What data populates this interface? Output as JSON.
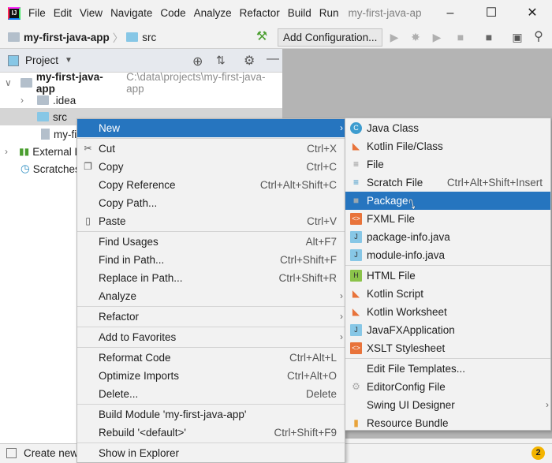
{
  "titlebar": {
    "menus": [
      "File",
      "Edit",
      "View",
      "Navigate",
      "Code",
      "Analyze",
      "Refactor",
      "Build",
      "Run"
    ],
    "title": "my-first-java-ap"
  },
  "toolbar": {
    "project": "my-first-java-app",
    "folder": "src",
    "add_config": "Add Configuration..."
  },
  "project_panel": {
    "title": "Project"
  },
  "tree": [
    {
      "label": "my-first-java-app",
      "path": "C:\\data\\projects\\my-first-java-app",
      "bold": true
    },
    {
      "label": ".idea"
    },
    {
      "label": "src"
    },
    {
      "label": "my-fi"
    },
    {
      "label": "External L"
    },
    {
      "label": "Scratches"
    }
  ],
  "status": {
    "text": "Create new",
    "badge": "2",
    "badge_color": "#f4b400"
  },
  "accent": "#2675bf",
  "context_menu": [
    {
      "label": "New",
      "submenu": true,
      "highlighted": true
    },
    {
      "sep": true
    },
    {
      "label": "Cut",
      "shortcut": "Ctrl+X",
      "icon": "scissors-icon"
    },
    {
      "label": "Copy",
      "shortcut": "Ctrl+C",
      "icon": "copy-icon"
    },
    {
      "label": "Copy Reference",
      "shortcut": "Ctrl+Alt+Shift+C"
    },
    {
      "label": "Copy Path...",
      "shortcut": ""
    },
    {
      "label": "Paste",
      "shortcut": "Ctrl+V",
      "icon": "clipboard-icon"
    },
    {
      "sep": true
    },
    {
      "label": "Find Usages",
      "shortcut": "Alt+F7"
    },
    {
      "label": "Find in Path...",
      "shortcut": "Ctrl+Shift+F"
    },
    {
      "label": "Replace in Path...",
      "shortcut": "Ctrl+Shift+R"
    },
    {
      "label": "Analyze",
      "submenu": true
    },
    {
      "sep": true
    },
    {
      "label": "Refactor",
      "submenu": true
    },
    {
      "sep": true
    },
    {
      "label": "Add to Favorites",
      "submenu": true
    },
    {
      "sep": true
    },
    {
      "label": "Reformat Code",
      "shortcut": "Ctrl+Alt+L"
    },
    {
      "label": "Optimize Imports",
      "shortcut": "Ctrl+Alt+O"
    },
    {
      "label": "Delete...",
      "shortcut": "Delete"
    },
    {
      "sep": true
    },
    {
      "label": "Build Module 'my-first-java-app'"
    },
    {
      "label": "Rebuild '<default>'",
      "shortcut": "Ctrl+Shift+F9"
    },
    {
      "sep": true
    },
    {
      "label": "Show in Explorer"
    }
  ],
  "new_submenu": [
    {
      "label": "Java Class",
      "icon": "java-class-icon"
    },
    {
      "label": "Kotlin File/Class",
      "icon": "kotlin-file-icon"
    },
    {
      "label": "File",
      "icon": "file-icon"
    },
    {
      "label": "Scratch File",
      "shortcut": "Ctrl+Alt+Shift+Insert",
      "icon": "scratch-file-icon"
    },
    {
      "label": "Package",
      "icon": "package-icon",
      "highlighted": true
    },
    {
      "label": "FXML File",
      "icon": "fxml-file-icon"
    },
    {
      "label": "package-info.java",
      "icon": "java-file-icon"
    },
    {
      "label": "module-info.java",
      "icon": "java-file-icon"
    },
    {
      "sep": true
    },
    {
      "label": "HTML File",
      "icon": "html-file-icon"
    },
    {
      "label": "Kotlin Script",
      "icon": "kotlin-script-icon"
    },
    {
      "label": "Kotlin Worksheet",
      "icon": "kotlin-worksheet-icon"
    },
    {
      "label": "JavaFXApplication",
      "icon": "javafx-icon"
    },
    {
      "label": "XSLT Stylesheet",
      "icon": "xslt-icon"
    },
    {
      "sep": true
    },
    {
      "label": "Edit File Templates..."
    },
    {
      "label": "EditorConfig File",
      "icon": "gear-icon"
    },
    {
      "label": "Swing UI Designer",
      "submenu": true
    },
    {
      "label": "Resource Bundle",
      "icon": "resource-bundle-icon"
    }
  ]
}
